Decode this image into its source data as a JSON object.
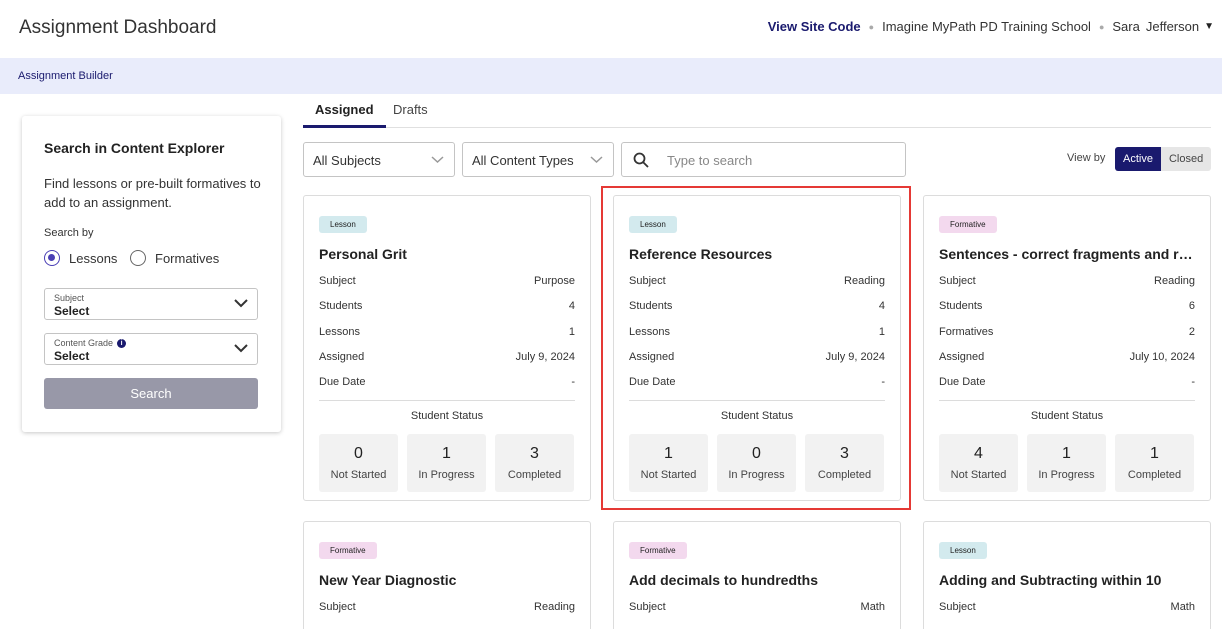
{
  "header": {
    "title": "Assignment Dashboard",
    "site_code_link": "View Site Code",
    "school": "Imagine MyPath PD Training School",
    "user_first": "Sara",
    "user_last": "Jefferson"
  },
  "subnav": {
    "link": "Assignment Builder"
  },
  "search_panel": {
    "title": "Search in Content Explorer",
    "description": "Find lessons or pre-built formatives to add to an assignment.",
    "search_by_label": "Search by",
    "options": [
      "Lessons",
      "Formatives"
    ],
    "selected_option": "Lessons",
    "subject": {
      "label": "Subject",
      "value": "Select"
    },
    "content_grade": {
      "label": "Content Grade",
      "value": "Select"
    },
    "search_button": "Search"
  },
  "tabs": [
    "Assigned",
    "Drafts"
  ],
  "active_tab": "Assigned",
  "filters": {
    "subjects": "All Subjects",
    "content_types": "All Content Types",
    "search_placeholder": "Type to search",
    "view_by_label": "View by",
    "view_active": "Active",
    "view_closed": "Closed"
  },
  "card_labels": {
    "student_status": "Student Status"
  },
  "cards": [
    {
      "type": "Lesson",
      "title": "Personal Grit",
      "rows": [
        [
          "Subject",
          "Purpose"
        ],
        [
          "Students",
          "4"
        ],
        [
          "Lessons",
          "1"
        ],
        [
          "Assigned",
          "July 9, 2024"
        ],
        [
          "Due Date",
          "-"
        ]
      ],
      "status": [
        [
          "0",
          "Not Started"
        ],
        [
          "1",
          "In Progress"
        ],
        [
          "3",
          "Completed"
        ]
      ]
    },
    {
      "type": "Lesson",
      "title": "Reference Resources",
      "rows": [
        [
          "Subject",
          "Reading"
        ],
        [
          "Students",
          "4"
        ],
        [
          "Lessons",
          "1"
        ],
        [
          "Assigned",
          "July 9, 2024"
        ],
        [
          "Due Date",
          "-"
        ]
      ],
      "status": [
        [
          "1",
          "Not Started"
        ],
        [
          "0",
          "In Progress"
        ],
        [
          "3",
          "Completed"
        ]
      ]
    },
    {
      "type": "Formative",
      "title": "Sentences - correct fragments and run-ons",
      "rows": [
        [
          "Subject",
          "Reading"
        ],
        [
          "Students",
          "6"
        ],
        [
          "Formatives",
          "2"
        ],
        [
          "Assigned",
          "July 10, 2024"
        ],
        [
          "Due Date",
          "-"
        ]
      ],
      "status": [
        [
          "4",
          "Not Started"
        ],
        [
          "1",
          "In Progress"
        ],
        [
          "1",
          "Completed"
        ]
      ]
    },
    {
      "type": "Formative",
      "title": "New Year Diagnostic",
      "rows": [
        [
          "Subject",
          "Reading"
        ]
      ]
    },
    {
      "type": "Formative",
      "title": "Add decimals to hundredths",
      "rows": [
        [
          "Subject",
          "Math"
        ]
      ]
    },
    {
      "type": "Lesson",
      "title": "Adding and Subtracting within 10",
      "rows": [
        [
          "Subject",
          "Math"
        ]
      ]
    }
  ],
  "colors": {
    "primary": "#1a1a6e",
    "subnav_bg": "#e9ecfb",
    "lesson_badge": "#d3eaee",
    "formative_badge": "#f3d9ee",
    "highlight": "#e53935"
  }
}
